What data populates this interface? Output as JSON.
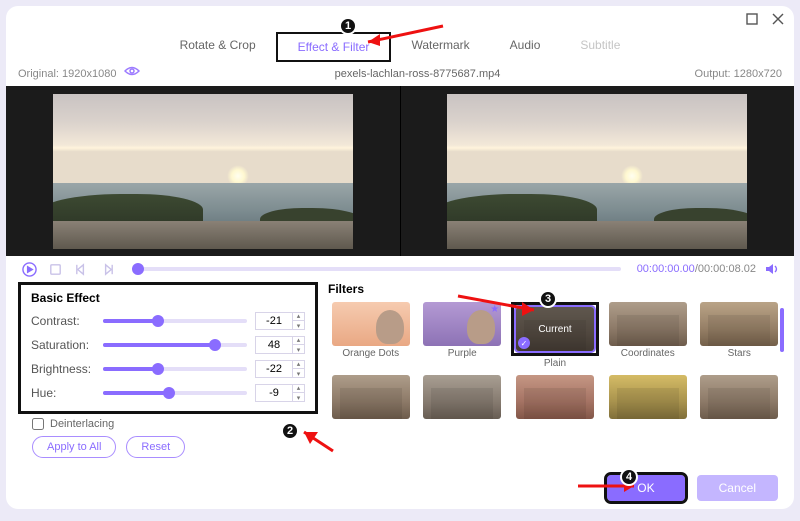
{
  "tabs": {
    "rotate": "Rotate & Crop",
    "effect": "Effect & Filter",
    "watermark": "Watermark",
    "audio": "Audio",
    "subtitle": "Subtitle"
  },
  "info": {
    "original_label": "Original:",
    "original_res": "1920x1080",
    "filename": "pexels-lachlan-ross-8775687.mp4",
    "output_label": "Output:",
    "output_res": "1280x720"
  },
  "playback": {
    "current": "00:00:00.00",
    "total": "00:00:08.02"
  },
  "basic": {
    "heading": "Basic Effect",
    "items": [
      {
        "label": "Contrast:",
        "value": "-21",
        "pct": 38
      },
      {
        "label": "Saturation:",
        "value": "48",
        "pct": 78
      },
      {
        "label": "Brightness:",
        "value": "-22",
        "pct": 38
      },
      {
        "label": "Hue:",
        "value": "-9",
        "pct": 46
      }
    ],
    "deinterlacing": "Deinterlacing",
    "apply_all": "Apply to All",
    "reset": "Reset"
  },
  "filters": {
    "heading": "Filters",
    "current_overlay": "Current",
    "row1": [
      {
        "label": "Orange Dots"
      },
      {
        "label": "Purple"
      },
      {
        "label": "Plain"
      },
      {
        "label": "Coordinates"
      },
      {
        "label": "Stars"
      }
    ],
    "row2": [
      {
        "label": ""
      },
      {
        "label": ""
      },
      {
        "label": ""
      },
      {
        "label": ""
      },
      {
        "label": ""
      }
    ]
  },
  "footer": {
    "ok": "OK",
    "cancel": "Cancel"
  },
  "badges": {
    "b1": "1",
    "b2": "2",
    "b3": "3",
    "b4": "4"
  }
}
